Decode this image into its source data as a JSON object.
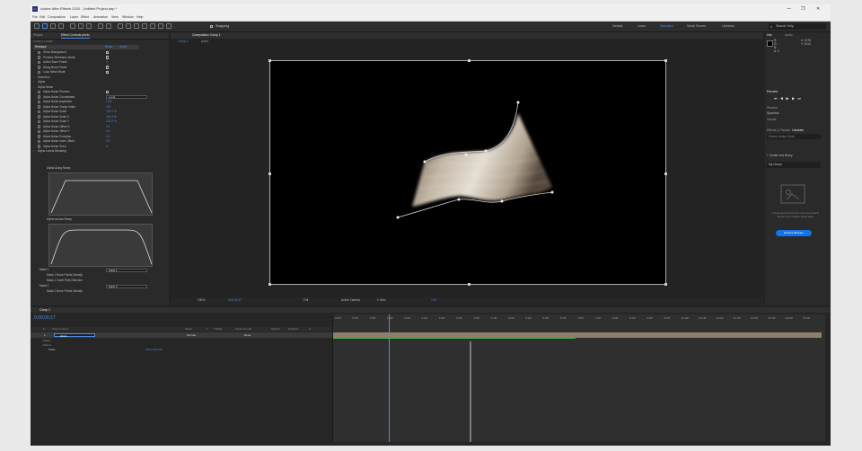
{
  "app": {
    "title": "Adobe After Effects 2020 - Untitled Project.aep *",
    "logo": "Ae",
    "window_controls": [
      "—",
      "❐",
      "✕"
    ]
  },
  "menu": [
    "File",
    "Edit",
    "Composition",
    "Layer",
    "Effect",
    "Animation",
    "View",
    "Window",
    "Help"
  ],
  "toolbar": {
    "snapping_label": "Snapping",
    "workspaces": [
      "Default",
      "Learn",
      "Standard",
      "Small Screen",
      "Libraries"
    ],
    "active_workspace": "Standard",
    "search_placeholder": "Search Help"
  },
  "left_panel": {
    "tabs": [
      "Project",
      "Effect Controls photo"
    ],
    "layer_path": "Comp 1 • photo",
    "effect_name": "Reshape",
    "reset_label": "Reset",
    "about_label": "About",
    "rows": [
      {
        "label": "Show Background",
        "type": "check"
      },
      {
        "label": "Preview Wireframe Mode",
        "type": "check"
      },
      {
        "label": "Active Bone Points",
        "type": "value",
        "value": "0"
      },
      {
        "label": "Along Bone Points",
        "type": "check"
      },
      {
        "label": "Loop Mesh Mode",
        "type": "check"
      },
      {
        "label": "Distortion",
        "type": "section"
      },
      {
        "label": "Alpha",
        "type": "section"
      },
      {
        "label": "Alpha Noise",
        "type": "section"
      },
      {
        "label": "Alpha Noise Preview",
        "type": "check"
      },
      {
        "label": "Alpha Noise Coordinates",
        "type": "drop",
        "value": "Local"
      },
      {
        "label": "Alpha Noise Amplitude",
        "type": "value",
        "value": "1.00"
      },
      {
        "label": "Alpha Noise Clamp Value",
        "type": "value",
        "value": "100"
      },
      {
        "label": "Alpha Noise Scale",
        "type": "value",
        "value": "100.0 %"
      },
      {
        "label": "Alpha Noise Scale X",
        "type": "value",
        "value": "100.0 %"
      },
      {
        "label": "Alpha Noise Scale Y",
        "type": "value",
        "value": "100.0 %"
      },
      {
        "label": "Alpha Noise Offset X",
        "type": "value",
        "value": "0.0"
      },
      {
        "label": "Alpha Noise Offset Y",
        "type": "value",
        "value": "0.0"
      },
      {
        "label": "Alpha Noise Evolution",
        "type": "value",
        "value": "0.0"
      },
      {
        "label": "Alpha Noise Inner Offset",
        "type": "value",
        "value": "0.0"
      },
      {
        "label": "Alpha Noise Seed",
        "type": "value",
        "value": "0"
      },
      {
        "label": "Alpha Levels Blending",
        "type": "section"
      }
    ],
    "ramp1_label": "Alpha Along Ramp",
    "ramp2_label": "Alpha Across Ramp",
    "mask_rows": [
      {
        "label": "Mask 1",
        "value": "Mask 1"
      },
      {
        "label": "Mask 1 Bone Points Density",
        "value": ""
      },
      {
        "label": "Mask 1 Invert Path Direction",
        "value": ""
      },
      {
        "label": "Mask 2",
        "value": "Mask 2"
      },
      {
        "label": "Mask 2 Bone Points Density",
        "value": ""
      }
    ]
  },
  "composition": {
    "tabs": [
      "Composition Comp 1"
    ],
    "breadcrumb": [
      "Comp 1",
      "photo"
    ],
    "zoom": "100%",
    "timecode": "0;00;00;17",
    "resolution": "Full",
    "camera": "Active Camera",
    "views": "1 View",
    "exposure": "+0.0"
  },
  "right_panel": {
    "info_tabs": [
      "Info",
      "Audio"
    ],
    "info_values": [
      "R:",
      "G:",
      "B:",
      "A: 0",
      "X: 1276",
      "Y: 1014"
    ],
    "preview_title": "Preview",
    "shortcut_label": "Shortcut",
    "shortcut_value": "Spacebar",
    "include_label": "Include:",
    "lib_tabs": [
      "Effects & Presets",
      "Libraries"
    ],
    "lib_search": "Search Adobe Stock",
    "create_library": "+ Create new library",
    "my_library": "My Library",
    "empty_text": "Create and access your most used assets across your Creative Cloud apps.",
    "explore_button": "Explore libraries"
  },
  "timeline": {
    "tab": "Comp 1",
    "timecode": "0;00;00;17",
    "search_placeholder": "",
    "columns": [
      "#",
      "Source Name",
      "Mode",
      "T",
      "TrkMat",
      "Parent & Link",
      "Stretch",
      "Duration",
      "In"
    ],
    "layer": {
      "index": "1",
      "name": "photo",
      "mode": "Normal",
      "parent": "None"
    },
    "sub_rows": [
      "Masks",
      "Effects",
      "Scale"
    ],
    "scale_value": "100.0,100.0%",
    "ruler": [
      "0:00f",
      "0:15f",
      "1:00f",
      "1:15f",
      "2:00f",
      "2:15f",
      "3:00f",
      "3:15f",
      "4:00f",
      "4:15f",
      "5:00f",
      "5:15f",
      "6:00f",
      "6:15f",
      "7:00f",
      "7:15f",
      "8:00f",
      "8:15f",
      "9:00f",
      "9:15f",
      "10:00f",
      "10:15f",
      "11:00f",
      "11:15f",
      "12:00f",
      "12:15f",
      "13:00f",
      "13:15f"
    ]
  }
}
